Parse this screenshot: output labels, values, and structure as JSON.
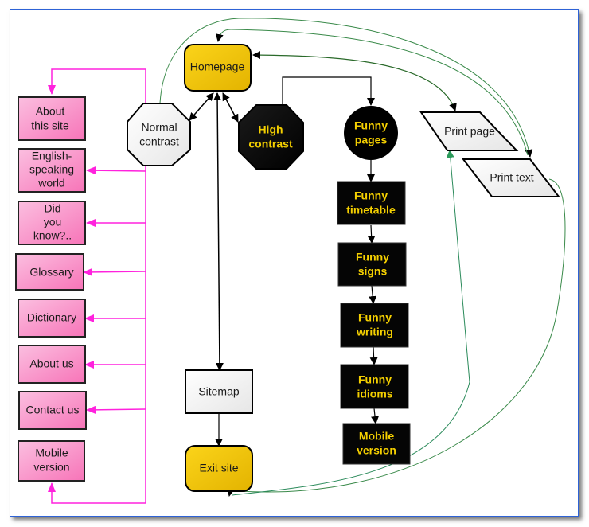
{
  "diagram": {
    "type": "website-sitemap-flowchart",
    "nodes": {
      "homepage": {
        "label": "Homepage",
        "shape": "rounded-rect",
        "fill": "#f5c518"
      },
      "normal_contrast": {
        "label": [
          "Normal",
          "contrast"
        ],
        "shape": "octagon",
        "fill": "#f4f4f4"
      },
      "high_contrast": {
        "label": [
          "High",
          "contrast"
        ],
        "shape": "octagon",
        "fill": "#000000"
      },
      "funny_pages": {
        "label": [
          "Funny",
          "pages"
        ],
        "shape": "circle",
        "fill": "#000000"
      },
      "funny_timetable": {
        "label": [
          "Funny",
          "timetable"
        ],
        "shape": "rect",
        "fill": "#000000"
      },
      "funny_signs": {
        "label": [
          "Funny",
          "signs"
        ],
        "shape": "rect",
        "fill": "#000000"
      },
      "funny_writing": {
        "label": [
          "Funny",
          "writing"
        ],
        "shape": "rect",
        "fill": "#000000"
      },
      "funny_idioms": {
        "label": [
          "Funny",
          "idioms"
        ],
        "shape": "rect",
        "fill": "#000000"
      },
      "mobile_version_dark": {
        "label": [
          "Mobile",
          "version"
        ],
        "shape": "rect",
        "fill": "#000000"
      },
      "print_page": {
        "label": "Print page",
        "shape": "parallelogram",
        "fill": "#f4f4f4"
      },
      "print_text": {
        "label": "Print text",
        "shape": "parallelogram",
        "fill": "#f4f4f4"
      },
      "sitemap": {
        "label": "Sitemap",
        "shape": "rect",
        "fill": "#f4f4f4"
      },
      "exit_site": {
        "label": "Exit site",
        "shape": "rounded-rect",
        "fill": "#e8b800"
      },
      "about_site": {
        "label": [
          "About",
          "this site"
        ],
        "shape": "rect",
        "fill": "#f9a0c8"
      },
      "english_world": {
        "label": [
          "English-",
          "speaking",
          "world"
        ],
        "shape": "rect",
        "fill": "#f9a0c8"
      },
      "did_you_know": {
        "label": [
          "Did",
          "you",
          "know?.."
        ],
        "shape": "rect",
        "fill": "#f9a0c8"
      },
      "glossary": {
        "label": "Glossary",
        "shape": "rect",
        "fill": "#f9a0c8"
      },
      "dictionary": {
        "label": "Dictionary",
        "shape": "rect",
        "fill": "#f9a0c8"
      },
      "about_us": {
        "label": "About us",
        "shape": "rect",
        "fill": "#f9a0c8"
      },
      "contact_us": {
        "label": "Contact us",
        "shape": "rect",
        "fill": "#f9a0c8"
      },
      "mobile_version_pink": {
        "label": [
          "Mobile",
          "version"
        ],
        "shape": "rect",
        "fill": "#f9a0c8"
      }
    },
    "edges": [
      {
        "from": "homepage",
        "to": "normal_contrast",
        "color": "#000000",
        "bidirectional": true
      },
      {
        "from": "homepage",
        "to": "high_contrast",
        "color": "#000000",
        "bidirectional": true
      },
      {
        "from": "homepage",
        "to": "sitemap",
        "color": "#000000",
        "bidirectional": true
      },
      {
        "from": "high_contrast",
        "to": "funny_pages",
        "color": "#000000"
      },
      {
        "from": "funny_pages",
        "to": "funny_timetable",
        "color": "#000000"
      },
      {
        "from": "funny_timetable",
        "to": "funny_signs",
        "color": "#000000"
      },
      {
        "from": "funny_signs",
        "to": "funny_writing",
        "color": "#000000"
      },
      {
        "from": "funny_writing",
        "to": "funny_idioms",
        "color": "#000000"
      },
      {
        "from": "funny_idioms",
        "to": "mobile_version_dark",
        "color": "#000000"
      },
      {
        "from": "sitemap",
        "to": "exit_site",
        "color": "#000000"
      },
      {
        "from": "normal_contrast",
        "to": "print_text",
        "color": "#3a8a4a"
      },
      {
        "from": "print_text",
        "to": "homepage",
        "color": "#3a8a4a"
      },
      {
        "from": "homepage",
        "to": "print_page",
        "color": "#3a8a4a",
        "bidirectional": true
      },
      {
        "from": "print_text",
        "to": "exit_site",
        "color": "#3a8a4a"
      },
      {
        "from": "exit_site",
        "to": "print_page",
        "color": "#3a8a4a"
      },
      {
        "from": "normal_contrast",
        "to": "about_site",
        "color": "#ff22dd"
      },
      {
        "from": "normal_contrast",
        "to": "english_world",
        "color": "#ff22dd"
      },
      {
        "from": "normal_contrast",
        "to": "did_you_know",
        "color": "#ff22dd"
      },
      {
        "from": "normal_contrast",
        "to": "glossary",
        "color": "#ff22dd"
      },
      {
        "from": "normal_contrast",
        "to": "dictionary",
        "color": "#ff22dd"
      },
      {
        "from": "normal_contrast",
        "to": "about_us",
        "color": "#ff22dd"
      },
      {
        "from": "normal_contrast",
        "to": "contact_us",
        "color": "#ff22dd"
      },
      {
        "from": "normal_contrast",
        "to": "mobile_version_pink",
        "color": "#ff22dd"
      }
    ]
  }
}
